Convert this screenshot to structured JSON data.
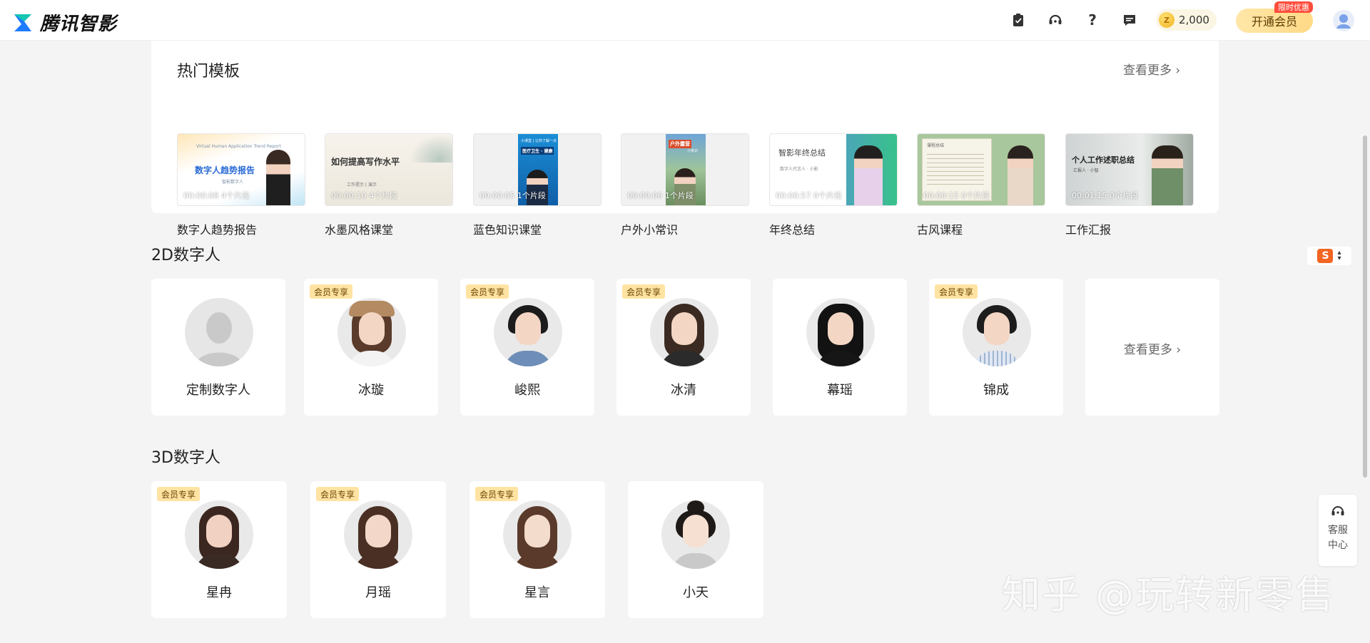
{
  "app": {
    "title": "腾讯智影",
    "coins": "2,000",
    "coin_glyph": "Z",
    "vip_button": "开通会员",
    "vip_tag": "限时优惠"
  },
  "templates": {
    "title": "热门模板",
    "more": "查看更多",
    "items": [
      {
        "label": "数字人趋势报告",
        "meta": "00:00:08  4个片段",
        "thumb_text": "数字人趋势报告",
        "thumb_sub": "Virtual Human Application Trend Report",
        "thumb_foot": "智影数字人"
      },
      {
        "label": "水墨风格课堂",
        "meta": "00:00:10  4个片段",
        "thumb_text": "如何提高写作水平",
        "thumb_sub": "工作提示 | 演示"
      },
      {
        "label": "蓝色知识课堂",
        "meta": "00:00:05  1个片段",
        "thumb_text": "医疗卫生 · 健康",
        "thumb_sub": "小课堂 | 让你了解一点"
      },
      {
        "label": "户外小常识",
        "meta": "00:00:06  1个片段",
        "thumb_text": "户外露营",
        "thumb_sub": "小常识"
      },
      {
        "label": "年终总结",
        "meta": "00:00:57  0个片段",
        "thumb_text": "智影年终总结",
        "thumb_sub": "数字人代言人 · 小影"
      },
      {
        "label": "古风课程",
        "meta": "00:00:15  0个片段",
        "thumb_text": "课程总结"
      },
      {
        "label": "工作汇报",
        "meta": "00:01:15  0个片段",
        "thumb_text": "个人工作述职总结",
        "thumb_sub": "汇报人 · 小智"
      }
    ]
  },
  "digital_2d": {
    "title": "2D数字人",
    "badge": "会员专享",
    "more": "查看更多",
    "items": [
      {
        "name": "定制数字人",
        "vip": false
      },
      {
        "name": "冰璇",
        "vip": true
      },
      {
        "name": "峻熙",
        "vip": true
      },
      {
        "name": "冰清",
        "vip": true
      },
      {
        "name": "幕瑶",
        "vip": false
      },
      {
        "name": "锦成",
        "vip": true
      }
    ]
  },
  "digital_3d": {
    "title": "3D数字人",
    "badge": "会员专享",
    "items": [
      {
        "name": "星冉",
        "vip": true
      },
      {
        "name": "月瑶",
        "vip": true
      },
      {
        "name": "星言",
        "vip": true
      },
      {
        "name": "小天",
        "vip": false
      }
    ]
  },
  "sidebar": {
    "support_label": "客服中心",
    "ime_glyph": "S"
  },
  "watermark": "知乎 @玩转新零售",
  "colors": {
    "accent": "#ffd986",
    "vip_badge": "#ffe3a3",
    "tag_red": "#ff4d3d",
    "background": "#f4f4f4"
  }
}
